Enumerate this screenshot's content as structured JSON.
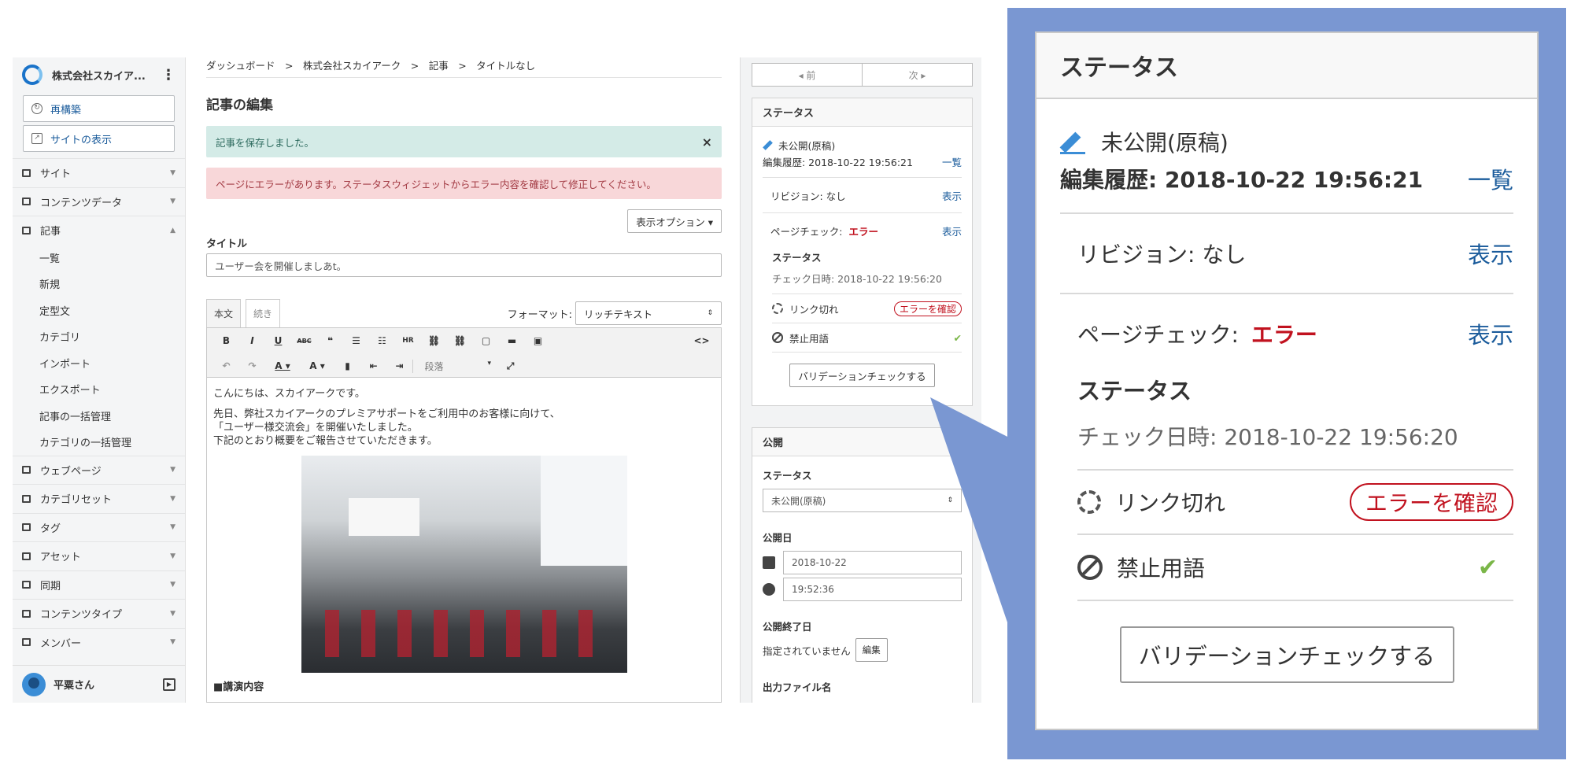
{
  "sidebar": {
    "org_name": "株式会社スカイア...",
    "rebuild_label": "再構築",
    "view_site_label": "サイトの表示",
    "menu": {
      "site": "サイト",
      "content_data": "コンテンツデータ",
      "articles": "記事",
      "articles_sub": [
        "一覧",
        "新規",
        "定型文",
        "カテゴリ",
        "インポート",
        "エクスポート",
        "記事の一括管理",
        "カテゴリの一括管理"
      ],
      "webpages": "ウェブページ",
      "category_sets": "カテゴリセット",
      "tags": "タグ",
      "assets": "アセット",
      "sync": "同期",
      "content_types": "コンテンツタイプ",
      "members": "メンバー"
    },
    "user_name": "平粟さん"
  },
  "main": {
    "breadcrumb": "ダッシュボード　>　株式会社スカイアーク　>　記事　>　タイトルなし",
    "page_title": "記事の編集",
    "alert_saved": "記事を保存しました。",
    "alert_close": "×",
    "alert_error": "ページにエラーがあります。ステータスウィジェットからエラー内容を確認して修正してください。",
    "display_options": "表示オプション ▾",
    "title_label": "タイトル",
    "title_value": "ユーザー会を開催しましあt。",
    "tab_body": "本文",
    "tab_more": "続き",
    "format_label": "フォーマット:",
    "format_value": "リッチテキスト",
    "format_arrow": "⇕",
    "toolbar_row1": [
      "B",
      "I",
      "U",
      "ABC",
      "❝",
      "☰",
      "☷",
      "HR",
      "⛓",
      "⛓",
      "▢",
      "▬",
      "▣"
    ],
    "toolbar_code": "<>",
    "toolbar_row2": [
      "↶",
      "↷",
      "A ▾",
      "A ▾",
      "▮",
      "⇤",
      "⇥"
    ],
    "paragraph_label": "段落",
    "paragraph_arrow": "▾",
    "expand_icon": "⤢",
    "body_p1": "こんにちは、スカイアークです。",
    "body_p2a": "先日、弊社スカイアークのプレミアサポートをご利用中のお客様に向けて、",
    "body_p2b": "「ユーザー様交流会」を開催いたしました。",
    "body_p2c": "下記のとおり概要をご報告させていただきます。",
    "body_h2": "■講演内容"
  },
  "right": {
    "prev": "◂ 前",
    "next": "次 ▸",
    "status": {
      "title": "ステータス",
      "state": "未公開(原稿)",
      "history_label": "編集履歴: 2018-10-22 19:56:21",
      "list_link": "一覧",
      "revision_label": "リビジョン: なし",
      "show_link": "表示",
      "page_check_label": "ページチェック:",
      "page_check_value": "エラー",
      "page_check_link": "表示",
      "sub_title": "ステータス",
      "check_date": "チェック日時: 2018-10-22 19:56:20",
      "broken_link_label": "リンク切れ",
      "broken_link_btn": "エラーを確認",
      "banned_words_label": "禁止用語",
      "banned_words_ok": "✔",
      "validate_btn": "バリデーションチェックする"
    },
    "publish": {
      "title": "公開",
      "status_label": "ステータス",
      "status_value": "未公開(原稿)",
      "status_arrow": "⇕",
      "date_label": "公開日",
      "date_value": "2018-10-22",
      "time_value": "19:52:36",
      "end_label": "公開終了日",
      "end_value": "指定されていません",
      "edit_btn": "編集",
      "filename_label": "出力ファイル名"
    }
  },
  "colors": {
    "accent": "#1a5b9b",
    "error": "#c1121f",
    "ok": "#7ab648",
    "zoom_bg": "#7a97d2"
  }
}
